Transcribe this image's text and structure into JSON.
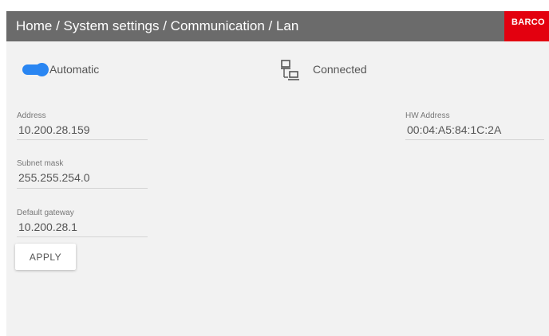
{
  "header": {
    "breadcrumb": "Home / System settings / Communication / Lan",
    "logo_text": "BARCO",
    "background_color": "#6b6b6b",
    "brand_color": "#e3000f"
  },
  "mode": {
    "toggle_label": "Automatic",
    "toggle_on": true,
    "accent_color": "#2a86f2"
  },
  "status": {
    "icon": "network-computers-icon",
    "label": "Connected"
  },
  "fields": {
    "address": {
      "label": "Address",
      "value": "10.200.28.159"
    },
    "subnet_mask": {
      "label": "Subnet mask",
      "value": "255.255.254.0"
    },
    "default_gateway": {
      "label": "Default gateway",
      "value": "10.200.28.1"
    },
    "hw_address": {
      "label": "HW Address",
      "value": "00:04:A5:84:1C:2A"
    }
  },
  "actions": {
    "apply_label": "APPLY"
  }
}
